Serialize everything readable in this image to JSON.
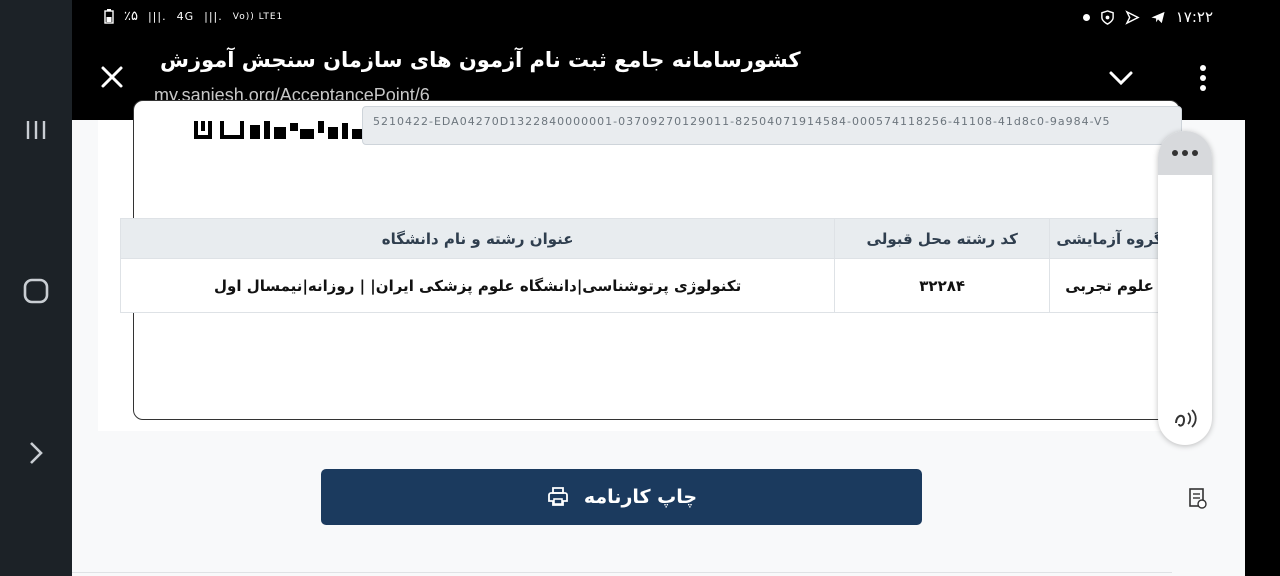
{
  "status_bar": {
    "battery": "٪۵",
    "network_1": "4G",
    "network_2": "Vo)) LTE1",
    "time": "۱۷:۲۲"
  },
  "browser": {
    "title": "کشورسامانه جامع ثبت نام آزمون های سازمان سنجش آموزش",
    "url": "my.sanjesh.org/AcceptancePoint/6"
  },
  "certificate": {
    "code": "5210422-EDA04270D1322840000001-03709270129011-82504071914584-000574118256-41108-41d8c0-9a984-V5"
  },
  "table": {
    "headers": [
      "گروه آزمایشی",
      "کد رشته محل قبولی",
      "عنوان رشته و نام دانشگاه"
    ],
    "row": {
      "group": "علوم تجربی",
      "code": "۳۲۲۸۴",
      "title": "تکنولوژی پرتوشناسی|دانشگاه علوم پزشکی ایران| | روزانه|نیمسال اول"
    }
  },
  "print_button": {
    "label": "چاپ کارنامه"
  },
  "icons": [
    "recents-icon",
    "home-icon",
    "back-icon",
    "close-icon",
    "chevron-down-icon",
    "more-vert-icon",
    "print-icon",
    "sound-icon",
    "document-icon"
  ]
}
